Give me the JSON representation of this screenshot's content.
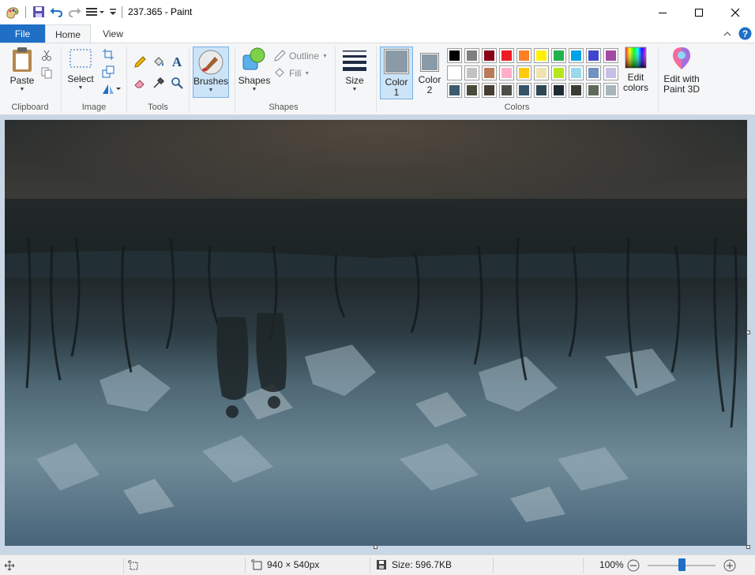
{
  "window": {
    "title": "237.365 - Paint"
  },
  "tabs": {
    "file": "File",
    "home": "Home",
    "view": "View"
  },
  "ribbon": {
    "clipboard": {
      "paste": "Paste",
      "group": "Clipboard"
    },
    "image": {
      "select": "Select",
      "group": "Image"
    },
    "tools": {
      "group": "Tools"
    },
    "brushes": {
      "label": "Brushes"
    },
    "shapes": {
      "label": "Shapes",
      "outline": "Outline",
      "fill": "Fill",
      "group": "Shapes"
    },
    "size": {
      "label": "Size"
    },
    "colors": {
      "color1_line1": "Color",
      "color1_line2": "1",
      "color2_line1": "Color",
      "color2_line2": "2",
      "edit_line1": "Edit",
      "edit_line2": "colors",
      "group": "Colors",
      "color1_value": "#8a9aa6",
      "color2_value": "#8a9aa6",
      "palette_row1": [
        "#000000",
        "#7f7f7f",
        "#880015",
        "#ed1c24",
        "#ff7f27",
        "#fff200",
        "#22b14c",
        "#00a2e8",
        "#3f48cc",
        "#a349a4"
      ],
      "palette_row2": [
        "#ffffff",
        "#c3c3c3",
        "#b97a57",
        "#ffaec9",
        "#ffc90e",
        "#efe4b0",
        "#b5e61d",
        "#99d9ea",
        "#7092be",
        "#c8bfe7"
      ],
      "palette_row3": [
        "#3d5a6e",
        "#4a4a3a",
        "#453c32",
        "#4f4d48",
        "#355368",
        "#2f4655",
        "#1f2b33",
        "#3a3a36",
        "#5d6a5a",
        "#a8b4bc"
      ]
    },
    "paint3d": {
      "line1": "Edit with",
      "line2": "Paint 3D"
    }
  },
  "status": {
    "dimensions": "940 × 540px",
    "size": "Size: 596.7KB",
    "zoom": "100%",
    "zoom_fraction": 0.5
  }
}
